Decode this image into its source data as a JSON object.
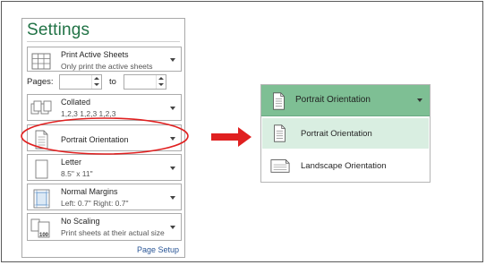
{
  "settings": {
    "title": "Settings",
    "print_what": {
      "title": "Print Active Sheets",
      "subtitle": "Only print the active sheets"
    },
    "pages": {
      "label": "Pages:",
      "to_label": "to",
      "from_value": "",
      "to_value": ""
    },
    "collation": {
      "title": "Collated",
      "subtitle": "1,2,3    1,2,3    1,2,3"
    },
    "orientation": {
      "title": "Portrait Orientation"
    },
    "paper": {
      "title": "Letter",
      "subtitle": "8.5\" x 11\""
    },
    "margins": {
      "title": "Normal Margins",
      "subtitle": "Left:  0.7\"    Right:  0.7\""
    },
    "scaling": {
      "title": "No Scaling",
      "subtitle": "Print sheets at their actual size",
      "icon_text": "100"
    },
    "page_setup_link": "Page Setup"
  },
  "orientation_dropdown": {
    "selected_label": "Portrait Orientation",
    "options": [
      {
        "label": "Portrait Orientation",
        "selected": true
      },
      {
        "label": "Landscape Orientation",
        "selected": false
      }
    ]
  },
  "colors": {
    "accent_green": "#217346",
    "header_green": "#7ebf94",
    "selected_green": "#d9eee1",
    "annotation_red": "#e02020",
    "link_blue": "#2b5797"
  }
}
